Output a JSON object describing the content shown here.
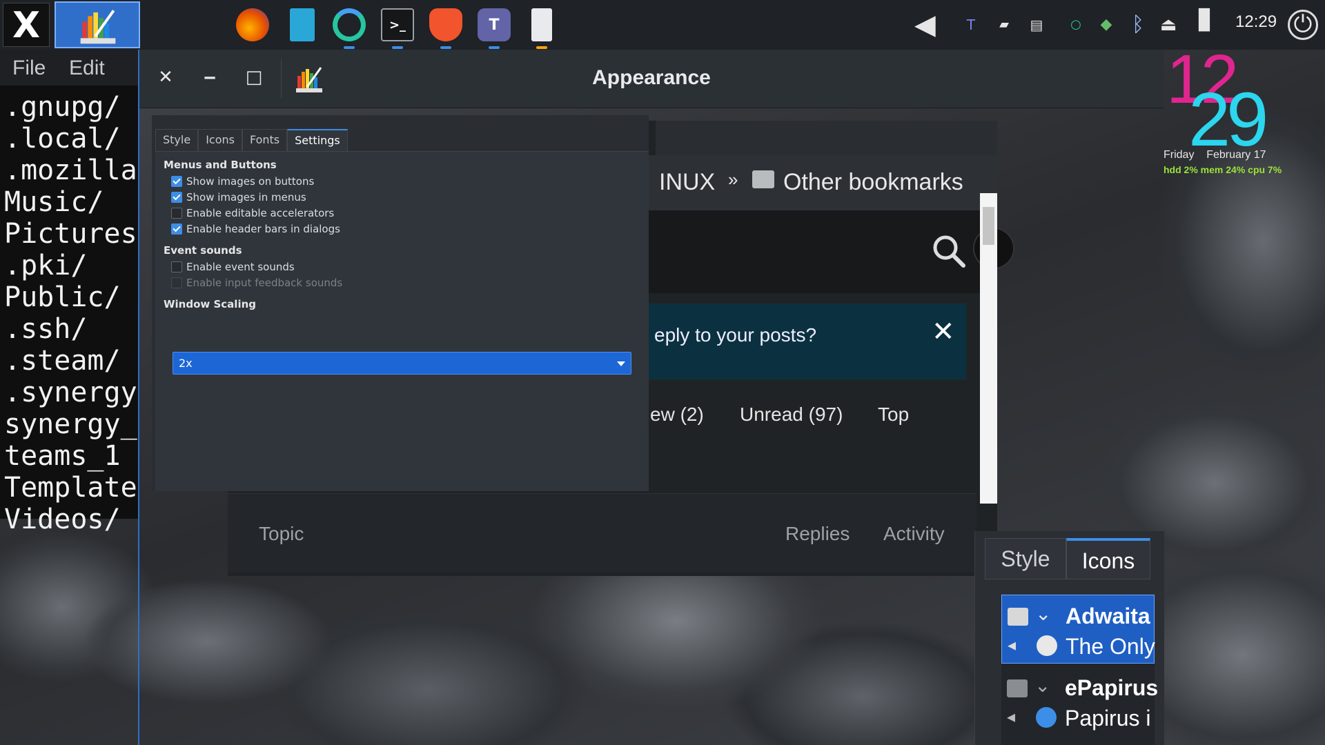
{
  "panel": {
    "clock": "12:29",
    "launcher_label": "X",
    "taskbar_icons": [
      "firefox-icon",
      "files-icon",
      "chromium-icon",
      "terminal-icon",
      "brave-icon",
      "teams-icon",
      "notes-icon"
    ],
    "tray_icons": [
      "volume-muted-icon",
      "teams-tray-icon",
      "chat-icon",
      "clipboard-icon",
      "status-circle-icon",
      "cube-icon",
      "bluetooth-icon",
      "eject-icon",
      "battery-icon",
      "logout-icon"
    ]
  },
  "terminal": {
    "menu": [
      "File",
      "Edit"
    ],
    "lines": [
      ".gnupg/",
      ".local/",
      ".mozilla",
      "Music/",
      "Pictures",
      ".pki/",
      "Public/",
      ".ssh/",
      ".steam/",
      ".synergy",
      "synergy_",
      "teams_1",
      "Template",
      "Videos/"
    ]
  },
  "browser": {
    "bookmark_partial": "INUX",
    "bookmark_more": "»",
    "other_bookmarks": "Other bookmarks",
    "banner_text": "eply to your posts?",
    "banner_close": "✕",
    "filters": [
      "ew (2)",
      "Unread (97)",
      "Top"
    ],
    "topic_header": "Topic",
    "replies_header": "Replies",
    "activity_header": "Activity"
  },
  "widget": {
    "hour": "12",
    "minute": "29",
    "day": "Friday",
    "date": "February 17",
    "stats": "hdd 2%  mem 24%  cpu     7%"
  },
  "appearance2": {
    "tabs": [
      "Style",
      "Icons"
    ],
    "themes": [
      {
        "name": "Adwaita",
        "desc": "The Only"
      },
      {
        "name": "ePapirus",
        "desc": "Papirus i"
      }
    ]
  },
  "dialog": {
    "title": "Appearance",
    "close": "✕",
    "minimize": "‒",
    "maximize": "□",
    "tabs": [
      "Style",
      "Icons",
      "Fonts",
      "Settings"
    ],
    "active_tab": "Settings",
    "menus_section": "Menus and Buttons",
    "options": [
      {
        "label": "Show images on buttons",
        "checked": true
      },
      {
        "label": "Show images in menus",
        "checked": true
      },
      {
        "label": "Enable editable accelerators",
        "checked": false
      },
      {
        "label": "Enable header bars in dialogs",
        "checked": true
      }
    ],
    "sounds_section": "Event sounds",
    "sound_options": [
      {
        "label": "Enable event sounds",
        "checked": false
      },
      {
        "label": "Enable input feedback sounds",
        "checked": false,
        "disabled": true
      }
    ],
    "scaling_section": "Window Scaling",
    "scaling_value": "2x"
  },
  "colors": {
    "accent": "#3d8ee6",
    "select_bg": "#1d66d6",
    "clock_hour": "#e0258f",
    "clock_minute": "#2bd6ee",
    "stats": "#9be23a"
  }
}
